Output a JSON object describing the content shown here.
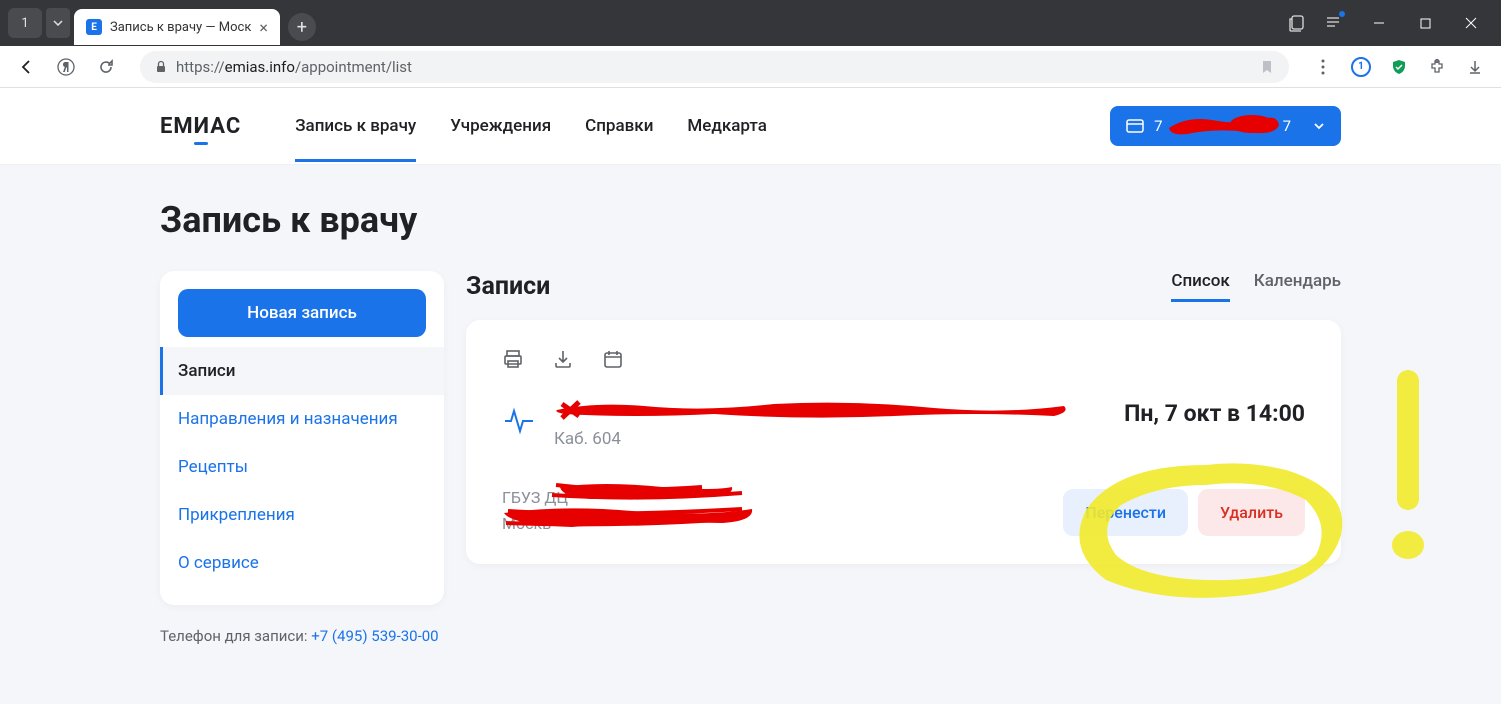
{
  "browser": {
    "tab_count": "1",
    "tab_title": "Запись к врачу — Моск",
    "url_prefix": "https://",
    "url_domain": "emias.info",
    "url_path": "/appointment/list"
  },
  "header": {
    "logo": "ЕМИАС",
    "nav": [
      "Запись к врачу",
      "Учреждения",
      "Справки",
      "Медкарта"
    ],
    "user_prefix": "7",
    "user_suffix": "7"
  },
  "page": {
    "title": "Запись к врачу"
  },
  "sidebar": {
    "new_btn": "Новая запись",
    "items": [
      "Записи",
      "Направления и назначения",
      "Рецепты",
      "Прикрепления",
      "О сервисе"
    ],
    "phone_label": "Телефон для записи: ",
    "phone": "+7 (495) 539-30-00"
  },
  "main": {
    "section_title": "Записи",
    "tabs": [
      "Список",
      "Календарь"
    ]
  },
  "appointment": {
    "room": "Каб. 604",
    "time": "Пн, 7 окт в 14:00",
    "org_prefix": "ГБУЗ ДЦ",
    "city_prefix": "Москв",
    "btn_move": "Перенести",
    "btn_delete": "Удалить"
  }
}
